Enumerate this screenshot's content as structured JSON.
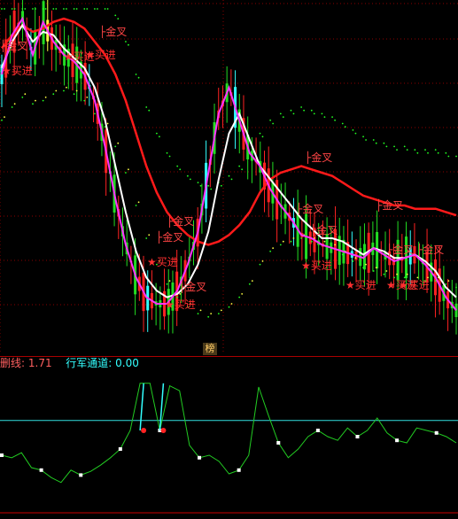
{
  "colors": {
    "background": "#000000",
    "grid": "#8b0000",
    "red_line": "#ff1a1a",
    "white_line": "#ffffff",
    "magenta_line": "#ff33ff",
    "green_dots": "#22ff22",
    "yellow_dots": "#ffff44",
    "up_candle": "#ff2222",
    "down_candle": "#22dd22",
    "cyan": "#33ffff",
    "osc_line": "#22cc22",
    "channel_line": "#33e0e0",
    "panel_title_red": "#ff6060",
    "panel_title_cyan": "#33ffff",
    "separator": "#cc0000"
  },
  "signals": {
    "gold": "金叉",
    "buy": "买进"
  },
  "badge": "榜",
  "panel2": {
    "line_label": "删线",
    "line_value": "1.71",
    "channel_label": "行军通道",
    "channel_value": "0.00"
  },
  "chart_data": {
    "type": "line",
    "title": "",
    "series": [
      {
        "values": [
          0.88,
          0.92,
          0.95,
          0.93,
          0.94,
          0.96,
          0.97,
          0.96,
          0.94,
          0.9,
          0.86,
          0.8,
          0.72,
          0.62,
          0.52,
          0.44,
          0.38,
          0.34,
          0.31,
          0.29,
          0.28,
          0.29,
          0.31,
          0.34,
          0.38,
          0.44,
          0.48,
          0.5,
          0.51,
          0.52,
          0.51,
          0.5,
          0.49,
          0.47,
          0.45,
          0.43,
          0.42,
          0.41,
          0.4,
          0.4,
          0.39,
          0.39,
          0.39,
          0.38,
          0.37
        ]
      },
      {
        "values": [
          0.82,
          0.9,
          0.95,
          0.9,
          0.93,
          0.92,
          0.88,
          0.85,
          0.82,
          0.76,
          0.66,
          0.52,
          0.38,
          0.26,
          0.18,
          0.14,
          0.12,
          0.13,
          0.16,
          0.22,
          0.32,
          0.48,
          0.62,
          0.68,
          0.6,
          0.52,
          0.48,
          0.44,
          0.4,
          0.36,
          0.33,
          0.3,
          0.3,
          0.29,
          0.27,
          0.25,
          0.27,
          0.26,
          0.24,
          0.24,
          0.25,
          0.23,
          0.2,
          0.15,
          0.12
        ]
      },
      {
        "values": [
          0.8,
          0.92,
          0.97,
          0.86,
          0.96,
          0.9,
          0.86,
          0.84,
          0.8,
          0.72,
          0.58,
          0.42,
          0.28,
          0.18,
          0.12,
          0.1,
          0.1,
          0.14,
          0.22,
          0.32,
          0.5,
          0.68,
          0.76,
          0.66,
          0.56,
          0.52,
          0.45,
          0.4,
          0.36,
          0.31,
          0.3,
          0.28,
          0.27,
          0.26,
          0.25,
          0.24,
          0.27,
          0.25,
          0.23,
          0.24,
          0.25,
          0.22,
          0.18,
          0.12,
          0.08
        ]
      }
    ],
    "oscillator": {
      "values": [
        0.4,
        0.38,
        0.42,
        0.3,
        0.28,
        0.22,
        0.18,
        0.28,
        0.24,
        0.27,
        0.32,
        0.38,
        0.45,
        0.6,
        0.98,
        0.98,
        0.6,
        0.96,
        0.92,
        0.48,
        0.38,
        0.4,
        0.35,
        0.25,
        0.28,
        0.4,
        0.95,
        0.72,
        0.5,
        0.38,
        0.45,
        0.55,
        0.6,
        0.55,
        0.52,
        0.62,
        0.55,
        0.6,
        0.7,
        0.58,
        0.52,
        0.5,
        0.62,
        0.6,
        0.58,
        0.55,
        0.5
      ],
      "baseline": 0.3
    }
  }
}
